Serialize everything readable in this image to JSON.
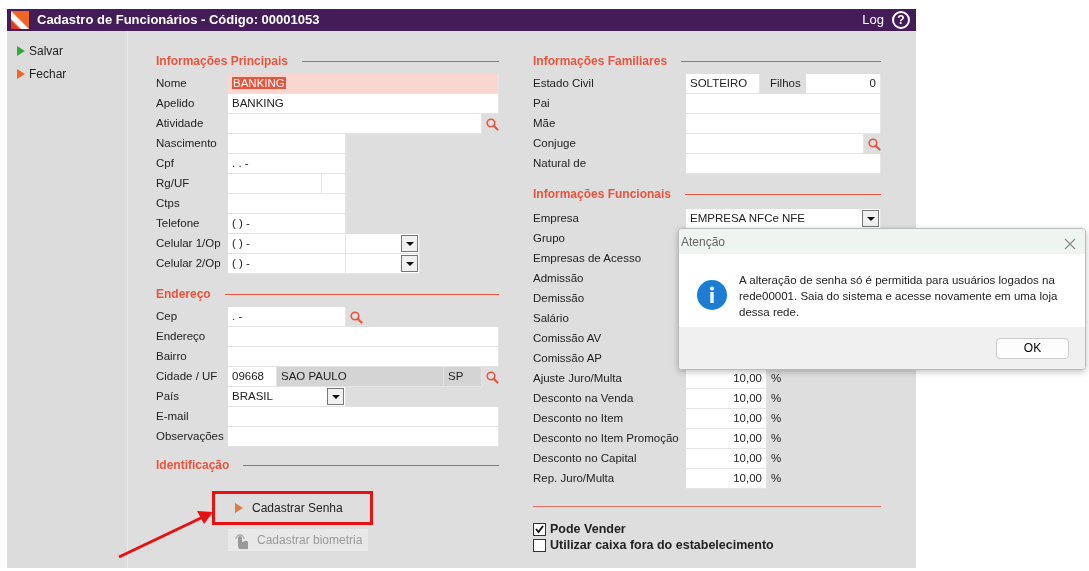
{
  "window": {
    "title": "Cadastro de Funcionários - Código: 00001053",
    "log": "Log",
    "help": "?"
  },
  "sidebar": [
    {
      "label": "Salvar",
      "kind": "save"
    },
    {
      "label": "Fechar",
      "kind": "close"
    }
  ],
  "left_sections": [
    {
      "title": "Informações Principais",
      "rows": [
        {
          "label": "Nome",
          "kind": "wide",
          "value": "BANKING",
          "focused": true
        },
        {
          "label": "Apelido",
          "kind": "wide",
          "value": "BANKING"
        },
        {
          "label": "Atividade",
          "kind": "wide-search"
        },
        {
          "label": "Nascimento",
          "kind": "short"
        },
        {
          "label": "Cpf",
          "kind": "short",
          "value": ". . -"
        },
        {
          "label": "Rg/UF",
          "kind": "split"
        },
        {
          "label": "Ctps",
          "kind": "short"
        },
        {
          "label": "Telefone",
          "kind": "short",
          "value": "( ) -"
        },
        {
          "label": "Celular 1/Op",
          "kind": "phone",
          "value": "( ) -"
        },
        {
          "label": "Celular 2/Op",
          "kind": "phone",
          "value": "( ) -"
        }
      ]
    },
    {
      "title": "Endereço",
      "rows": [
        {
          "label": "Cep",
          "kind": "short-search",
          "value": ". -"
        },
        {
          "label": "Endereço",
          "kind": "wide"
        },
        {
          "label": "Bairro",
          "kind": "wide"
        },
        {
          "label": "Cidade / UF",
          "kind": "city",
          "values": [
            "09668",
            "SAO PAULO",
            "SP"
          ]
        },
        {
          "label": "País",
          "kind": "select-short",
          "value": "BRASIL"
        },
        {
          "label": "E-mail",
          "kind": "wide"
        },
        {
          "label": "Observações",
          "kind": "wide"
        }
      ]
    }
  ],
  "identificacao": {
    "title": "Identificação",
    "buttons": [
      {
        "label": "Cadastrar Senha",
        "kind": "password",
        "disabled": false,
        "highlighted": true
      },
      {
        "label": "Cadastrar biometria",
        "kind": "biometric",
        "disabled": true,
        "highlighted": false
      }
    ]
  },
  "right_sections": [
    {
      "title": "Informações Familiares",
      "rows": [
        {
          "label": "Estado Civil",
          "kind": "pair",
          "value": "SOLTEIRO",
          "extra_label": "Filhos",
          "extra_value": "0"
        },
        {
          "label": "Pai",
          "kind": "wide"
        },
        {
          "label": "Mãe",
          "kind": "wide"
        },
        {
          "label": "Conjuge",
          "kind": "wide-search"
        },
        {
          "label": "Natural de",
          "kind": "wide"
        }
      ]
    },
    {
      "title": "Informações Funcionais",
      "rows": [
        {
          "label": "Empresa",
          "kind": "select-wide",
          "value": "EMPRESA NFCe NFE"
        },
        {
          "label": "Grupo",
          "kind": "label"
        },
        {
          "label": "Empresas de Acesso",
          "kind": "label"
        },
        {
          "label": "Admissão",
          "kind": "label"
        },
        {
          "label": "Demissão",
          "kind": "label"
        },
        {
          "label": "Salário",
          "kind": "label"
        },
        {
          "label": "Comissão AV",
          "kind": "label"
        },
        {
          "label": "Comissão AP",
          "kind": "label"
        },
        {
          "label": "Ajuste Juro/Multa",
          "kind": "percent",
          "value": "10,00",
          "unit": "%"
        },
        {
          "label": "Desconto na Venda",
          "kind": "percent",
          "value": "10,00",
          "unit": "%"
        },
        {
          "label": "Desconto no Item",
          "kind": "percent",
          "value": "10,00",
          "unit": "%"
        },
        {
          "label": "Desconto no Item Promoção",
          "kind": "percent",
          "value": "10,00",
          "unit": "%"
        },
        {
          "label": "Desconto no Capital",
          "kind": "percent",
          "value": "10,00",
          "unit": "%"
        },
        {
          "label": "Rep. Juro/Multa",
          "kind": "percent",
          "value": "10,00",
          "unit": "%"
        }
      ]
    }
  ],
  "checkboxes": [
    {
      "label": "Pode Vender",
      "checked": true
    },
    {
      "label": "Utilizar caixa fora do estabelecimento",
      "checked": false
    }
  ],
  "dialog": {
    "title": "Atenção",
    "message": "A alteração de senha só é permitida para usuários logados na rede00001. Saia do sistema e acesse novamente em uma loja dessa rede.",
    "button": "OK"
  }
}
